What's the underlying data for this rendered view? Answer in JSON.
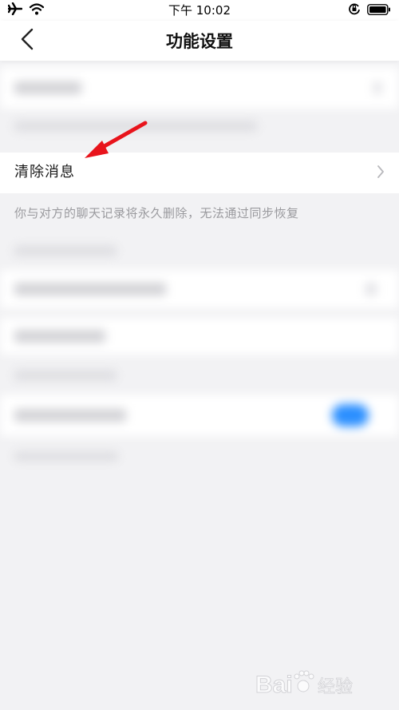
{
  "status_bar": {
    "time": "下午 10:02",
    "icons": [
      "airplane-icon",
      "wifi-icon",
      "orientation-lock-icon",
      "battery-icon"
    ]
  },
  "nav": {
    "title": "功能设置",
    "back_icon": "chevron-left-icon"
  },
  "settings": {
    "clear_messages": {
      "label": "清除消息",
      "note": "你与对方的聊天记录将永久删除，无法通过同步恢复"
    }
  },
  "annotation": {
    "arrow_color": "#e8141c"
  },
  "watermark": {
    "text": "经验"
  },
  "colors": {
    "background": "#f2f2f4",
    "cell": "#ffffff",
    "toggle_blue": "#2b8fff"
  }
}
